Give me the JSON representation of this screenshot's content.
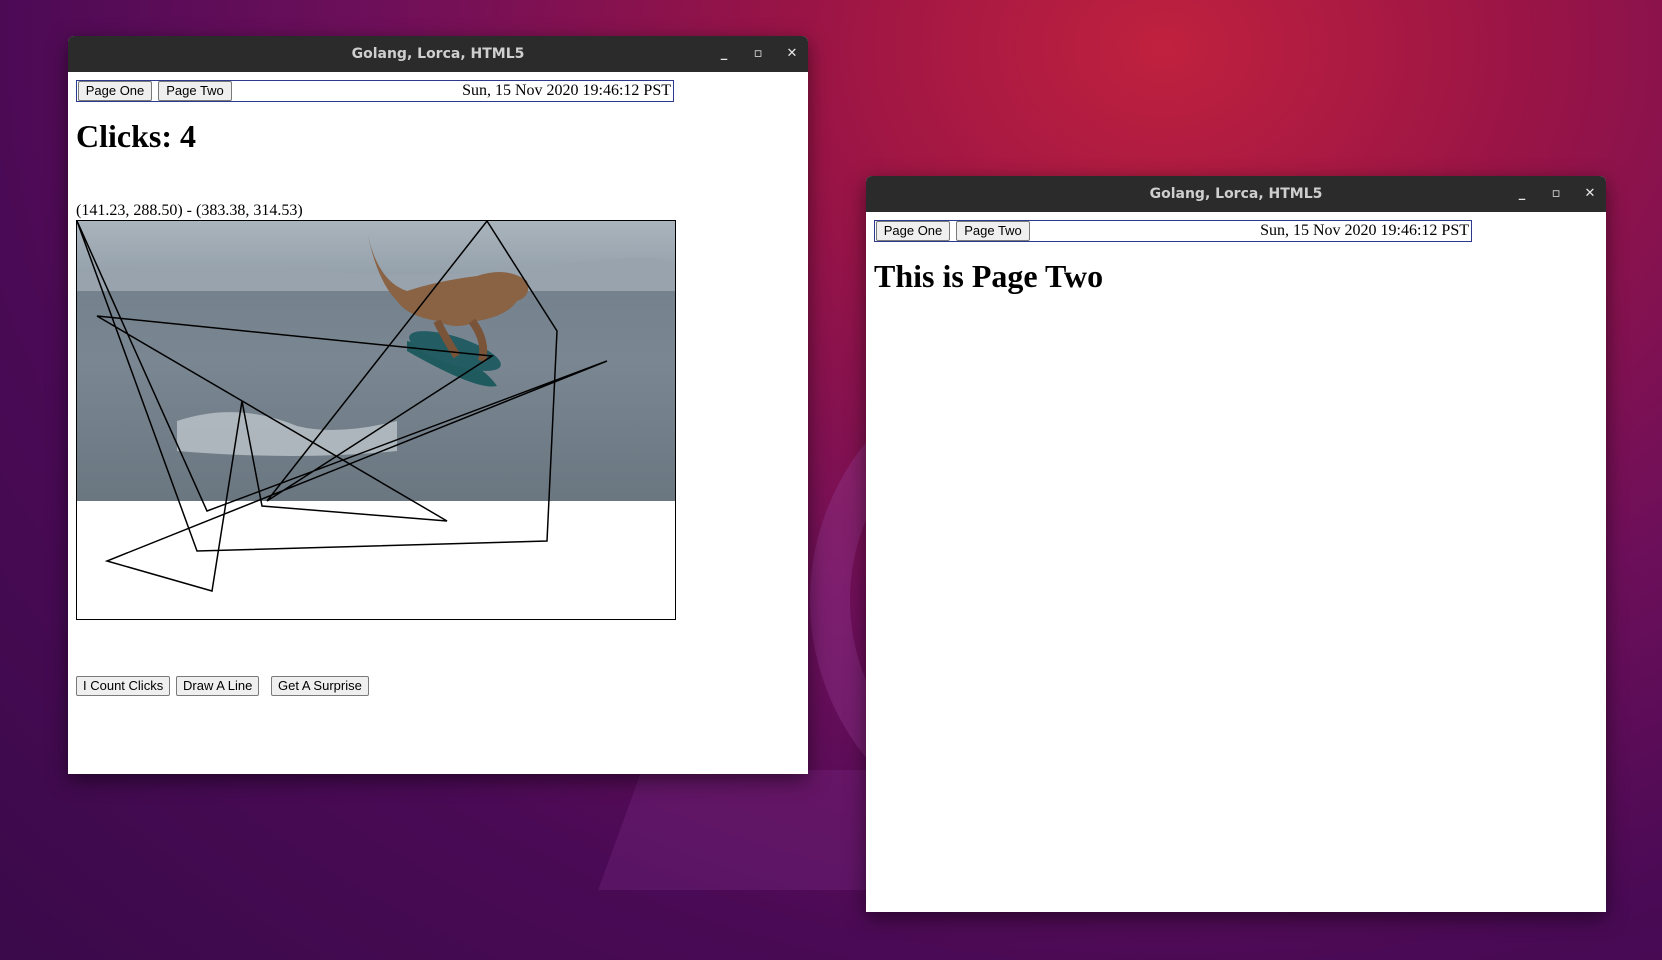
{
  "window_one": {
    "title": "Golang, Lorca, HTML5",
    "nav": {
      "page_one": "Page One",
      "page_two": "Page Two"
    },
    "datetime": "Sun, 15 Nov 2020 19:46:12 PST",
    "heading": "Clicks: 4",
    "coordinates": "(141.23, 288.50) - (383.38, 314.53)",
    "buttons": {
      "count_clicks": "I Count Clicks",
      "draw_line": "Draw A Line",
      "surprise": "Get A Surprise"
    },
    "canvas_image": "dinosaur-on-jetski-photo"
  },
  "window_two": {
    "title": "Golang, Lorca, HTML5",
    "nav": {
      "page_one": "Page One",
      "page_two": "Page Two"
    },
    "datetime": "Sun, 15 Nov 2020 19:46:12 PST",
    "heading": "This is Page Two"
  },
  "window_controls": {
    "minimize": "minimize-icon",
    "maximize": "maximize-icon",
    "close": "close-icon"
  },
  "colors": {
    "titlebar": "#2b2b2b",
    "nav_border": "#2b3a8e"
  }
}
